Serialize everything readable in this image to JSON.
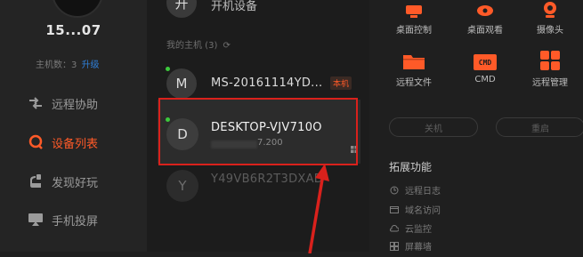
{
  "sidebar": {
    "user_id": "15...07",
    "host_count": "主机数：3",
    "upgrade_link": "升级",
    "items": [
      {
        "label": "远程协助",
        "icon": "remote-assist-icon"
      },
      {
        "label": "设备列表",
        "icon": "device-list-icon"
      },
      {
        "label": "发现好玩",
        "icon": "discover-icon"
      },
      {
        "label": "手机投屏",
        "icon": "phone-cast-icon"
      }
    ],
    "active_color": "#ff5a28"
  },
  "device_list": {
    "boot_device": {
      "avatar": "开",
      "label": "开机设备"
    },
    "group_title": "我的主机 (3)",
    "devices": [
      {
        "avatar": "M",
        "name": "MS-20161114YD...",
        "badge": "本机",
        "online": true
      },
      {
        "avatar": "D",
        "name": "DESKTOP-VJV710O",
        "ip_suffix": "7.200",
        "online": true,
        "selected": true
      },
      {
        "avatar": "Y",
        "name": "Y49VB6R2T3DXAD",
        "online": false
      }
    ],
    "online_color": "#3cc93c",
    "highlight_color": "#d9211c"
  },
  "tools": {
    "desktop_control": "桌面控制",
    "desktop_view": "桌面观看",
    "camera": "摄像头",
    "remote_file": "远程文件",
    "cmd": "CMD",
    "cmd_icon_text": "CMD",
    "remote_manage": "远程管理",
    "accent": "#ff5a28"
  },
  "actions": {
    "shutdown": "关机",
    "restart": "重启"
  },
  "extensions": {
    "title": "拓展功能",
    "items": [
      {
        "label": "远程日志",
        "icon": "log-icon"
      },
      {
        "label": "域名访问",
        "icon": "domain-icon"
      },
      {
        "label": "云监控",
        "icon": "cloud-monitor-icon"
      },
      {
        "label": "屏幕墙",
        "icon": "screen-wall-icon"
      }
    ]
  }
}
